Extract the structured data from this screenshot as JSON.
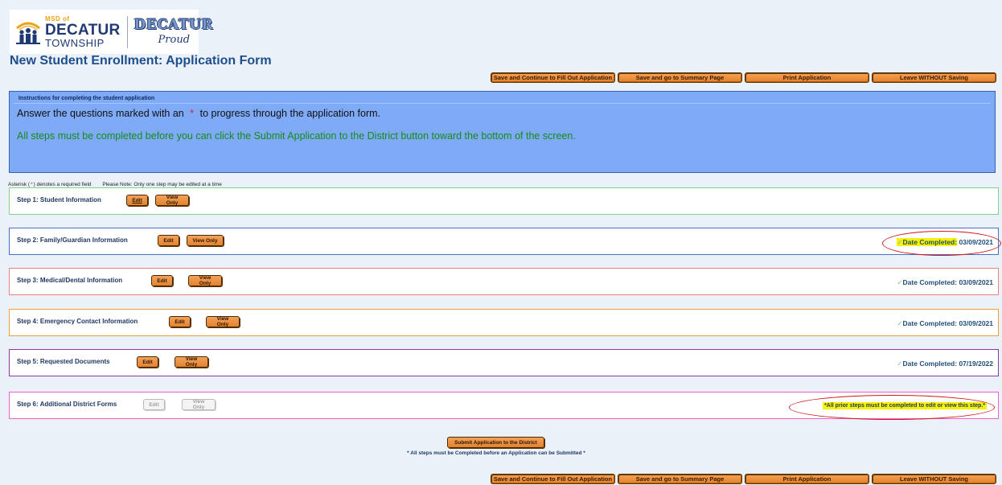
{
  "logo": {
    "msd": "MSD of",
    "decatur": "DECATUR",
    "township": "TOWNSHIP",
    "proud_top": "DECATUR",
    "proud_bottom": "Proud"
  },
  "page_title": "New Student Enrollment: Application Form",
  "toolbar": {
    "save_continue": "Save and Continue to Fill Out Application",
    "save_summary": "Save and go to Summary Page",
    "print": "Print Application",
    "leave": "Leave WITHOUT Saving"
  },
  "instructions": {
    "title": "Instructions for completing the student application",
    "line1_before": "Answer the questions marked with an",
    "star": "*",
    "line1_after": "to progress through the application form.",
    "line2": "All steps must be completed before you can click the Submit Application to the District button toward the bottom of the screen."
  },
  "notes": {
    "asterisk_before": "Asterisk (",
    "star": "*",
    "asterisk_after": ") denotes a required field",
    "one_step": "Please Note: Only one step may be edited at a time"
  },
  "buttons": {
    "edit": "Edit",
    "view_only": "View Only"
  },
  "date_label": "Date Completed:",
  "check_glyph": "✓",
  "steps": [
    {
      "title": "Step 1: Student Information",
      "date": ""
    },
    {
      "title": "Step 2: Family/Guardian Information",
      "date": "03/09/2021"
    },
    {
      "title": "Step 3: Medical/Dental Information",
      "date": "03/09/2021"
    },
    {
      "title": "Step 4: Emergency Contact Information",
      "date": "03/09/2021"
    },
    {
      "title": "Step 5: Requested Documents",
      "date": "07/19/2022"
    },
    {
      "title": "Step 6: Additional District Forms",
      "message": "*All prior steps must be completed to edit or view this step.*"
    }
  ],
  "submit": {
    "label": "Submit Application to the District",
    "note": "* All steps must be Completed before an Application can be Submitted *"
  },
  "colors": {
    "step1_border": "#7fd38f",
    "step2_border": "#4a6fc8",
    "step3_border": "#f08080",
    "step4_border": "#f0a030",
    "step5_border": "#8a3c9a",
    "step6_border": "#f060c8",
    "button_orange": "#e8893a",
    "instruction_bg": "#7eaaf7",
    "highlight": "#f6f200",
    "annotation_red": "#d01818"
  }
}
